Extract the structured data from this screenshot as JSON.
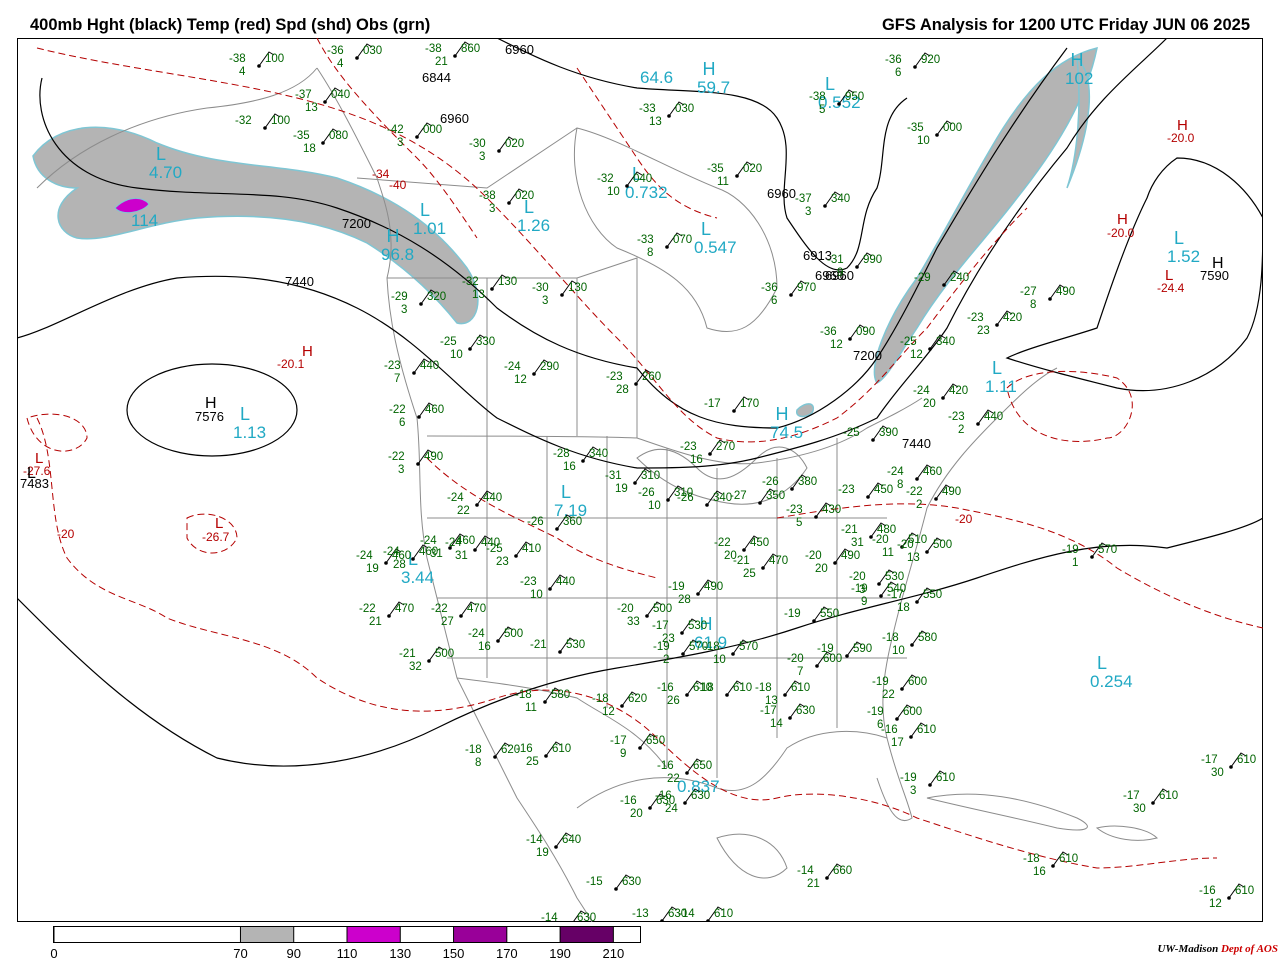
{
  "header": {
    "title_left": "400mb Hght (black) Temp (red) Spd (shd) Obs (grn)",
    "title_right": "GFS Analysis for 1200 UTC Friday  JUN 06 2025"
  },
  "colors": {
    "height_contour": "#000000",
    "temperature_contour": "#b40000",
    "speed_70_90": "#b4b4b4",
    "speed_110_130": "#cc00cc",
    "speed_150_170": "#990099",
    "speed_190_210": "#660066",
    "observation": "#006400",
    "feature_cyan": "#21a9c4",
    "border": "#8c8c8c"
  },
  "legend": {
    "ticks": [
      "0",
      "70",
      "90",
      "110",
      "130",
      "150",
      "170",
      "190",
      "210"
    ],
    "tick_values": [
      0,
      70,
      90,
      110,
      130,
      150,
      170,
      190,
      210
    ],
    "shaded_bands": [
      {
        "from": 70,
        "to": 90,
        "color": "#b4b4b4"
      },
      {
        "from": 110,
        "to": 130,
        "color": "#cc00cc"
      },
      {
        "from": 150,
        "to": 170,
        "color": "#990099"
      },
      {
        "from": 190,
        "to": 210,
        "color": "#660066"
      }
    ]
  },
  "credit": {
    "org": "UW-Madison",
    "dept": "Dept of AOS"
  },
  "height_labels": [
    "6960",
    "6844",
    "6960",
    "6960",
    "6960",
    "7200",
    "7440",
    "6913",
    "6960",
    "7200",
    "7440",
    "7576",
    "7483",
    "7590"
  ],
  "temp_labels": [
    "-20.0",
    "-20.0",
    "-24.4",
    "-20.1",
    "-27.6",
    "-26.7",
    "-20",
    "-20",
    "-40",
    "-34"
  ],
  "pressure_centers": [
    {
      "type": "H",
      "value": "7576"
    },
    {
      "type": "L",
      "value": "7483"
    },
    {
      "type": "H",
      "value": "7590"
    }
  ],
  "speed_features": [
    {
      "type": "L",
      "value": "4.70"
    },
    {
      "type": "",
      "value": "114"
    },
    {
      "type": "L",
      "value": "1.13"
    },
    {
      "type": "H",
      "value": "102"
    },
    {
      "type": "L",
      "value": "1.52"
    },
    {
      "type": "L",
      "value": "1.11"
    },
    {
      "type": "H",
      "value": "74.5"
    },
    {
      "type": "L",
      "value": "7.19"
    },
    {
      "type": "L",
      "value": "3.44"
    },
    {
      "type": "H",
      "value": "61.9"
    },
    {
      "type": "L",
      "value": "0.254"
    },
    {
      "type": "L",
      "value": "1.26"
    },
    {
      "type": "L",
      "value": "0.732"
    },
    {
      "type": "L",
      "value": "0.547"
    },
    {
      "type": "L",
      "value": "0.552"
    },
    {
      "type": "H",
      "value": "96.8"
    },
    {
      "type": "L",
      "value": "1.01"
    },
    {
      "type": "",
      "value": "0.837"
    },
    {
      "type": "H",
      "value": "59.7"
    },
    {
      "type": "",
      "value": "64.6"
    }
  ],
  "observations": [
    {
      "t": "-38",
      "h": "100",
      "dp": "4"
    },
    {
      "t": "-36",
      "h": "030",
      "dp": "4"
    },
    {
      "t": "-38",
      "h": "860",
      "dp": "21"
    },
    {
      "t": "-37",
      "h": "040",
      "dp": "13"
    },
    {
      "t": "-42",
      "h": "000",
      "dp": "3"
    },
    {
      "t": "-32",
      "h": "100",
      "dp": ""
    },
    {
      "t": "-35",
      "h": "080",
      "dp": "18"
    },
    {
      "t": "-30",
      "h": "020",
      "dp": "3"
    },
    {
      "t": "-38",
      "h": "020",
      "dp": "3"
    },
    {
      "t": "-32",
      "h": "040",
      "dp": "10"
    },
    {
      "t": "-33",
      "h": "030",
      "dp": "13"
    },
    {
      "t": "-35",
      "h": "020",
      "dp": "11"
    },
    {
      "t": "-37",
      "h": "340",
      "dp": "3"
    },
    {
      "t": "-36",
      "h": "920",
      "dp": "6"
    },
    {
      "t": "-38",
      "h": "950",
      "dp": "5"
    },
    {
      "t": "-35",
      "h": "000",
      "dp": "10"
    },
    {
      "t": "-33",
      "h": "070",
      "dp": "8"
    },
    {
      "t": "-31",
      "h": "990",
      "dp": "9"
    },
    {
      "t": "-29",
      "h": "240",
      "dp": ""
    },
    {
      "t": "-27",
      "h": "490",
      "dp": "8"
    },
    {
      "t": "-36",
      "h": "970",
      "dp": "6"
    },
    {
      "t": "-32",
      "h": "130",
      "dp": "13"
    },
    {
      "t": "-30",
      "h": "130",
      "dp": "3"
    },
    {
      "t": "-29",
      "h": "320",
      "dp": "3"
    },
    {
      "t": "-25",
      "h": "330",
      "dp": "10"
    },
    {
      "t": "-24",
      "h": "290",
      "dp": "12"
    },
    {
      "t": "-23",
      "h": "260",
      "dp": "28"
    },
    {
      "t": "-36",
      "h": "090",
      "dp": "12"
    },
    {
      "t": "-25",
      "h": "340",
      "dp": "12"
    },
    {
      "t": "-23",
      "h": "420",
      "dp": "23"
    },
    {
      "t": "-23",
      "h": "440",
      "dp": "7"
    },
    {
      "t": "-22",
      "h": "460",
      "dp": "6"
    },
    {
      "t": "-17",
      "h": "170",
      "dp": ""
    },
    {
      "t": "-24",
      "h": "420",
      "dp": "20"
    },
    {
      "t": "-23",
      "h": "440",
      "dp": "2"
    },
    {
      "t": "-22",
      "h": "490",
      "dp": "3"
    },
    {
      "t": "-28",
      "h": "340",
      "dp": "16"
    },
    {
      "t": "-23",
      "h": "270",
      "dp": "16"
    },
    {
      "t": "-25",
      "h": "390",
      "dp": ""
    },
    {
      "t": "-31",
      "h": "310",
      "dp": "19"
    },
    {
      "t": "-26",
      "h": "310",
      "dp": "10"
    },
    {
      "t": "-26",
      "h": "340",
      "dp": ""
    },
    {
      "t": "-27",
      "h": "350",
      "dp": ""
    },
    {
      "t": "-26",
      "h": "380",
      "dp": ""
    },
    {
      "t": "-23",
      "h": "450",
      "dp": ""
    },
    {
      "t": "-24",
      "h": "460",
      "dp": "8"
    },
    {
      "t": "-22",
      "h": "490",
      "dp": "2"
    },
    {
      "t": "-24",
      "h": "440",
      "dp": "22"
    },
    {
      "t": "-26",
      "h": "360",
      "dp": ""
    },
    {
      "t": "-23",
      "h": "430",
      "dp": "5"
    },
    {
      "t": "-21",
      "h": "480",
      "dp": "31"
    },
    {
      "t": "-20",
      "h": "510",
      "dp": "11"
    },
    {
      "t": "-20",
      "h": "500",
      "dp": "13"
    },
    {
      "t": "-24",
      "h": "460",
      "dp": "19"
    },
    {
      "t": "-24",
      "h": "460",
      "dp": "28"
    },
    {
      "t": "-24",
      "h": "460",
      "dp": "31"
    },
    {
      "t": "-24",
      "h": "440",
      "dp": "31"
    },
    {
      "t": "-25",
      "h": "410",
      "dp": "23"
    },
    {
      "t": "-22",
      "h": "450",
      "dp": "20"
    },
    {
      "t": "-21",
      "h": "470",
      "dp": "25"
    },
    {
      "t": "-20",
      "h": "490",
      "dp": "20"
    },
    {
      "t": "-20",
      "h": "530",
      "dp": "3"
    },
    {
      "t": "-19",
      "h": "540",
      "dp": "9"
    },
    {
      "t": "-17",
      "h": "550",
      "dp": "18"
    },
    {
      "t": "-19",
      "h": "570",
      "dp": "1"
    },
    {
      "t": "-23",
      "h": "440",
      "dp": "10"
    },
    {
      "t": "-19",
      "h": "490",
      "dp": "28"
    },
    {
      "t": "-22",
      "h": "470",
      "dp": "21"
    },
    {
      "t": "-22",
      "h": "470",
      "dp": "27"
    },
    {
      "t": "-24",
      "h": "500",
      "dp": "16"
    },
    {
      "t": "-20",
      "h": "500",
      "dp": "33"
    },
    {
      "t": "-17",
      "h": "530",
      "dp": "23"
    },
    {
      "t": "-19",
      "h": "550",
      "dp": ""
    },
    {
      "t": "-21",
      "h": "500",
      "dp": "32"
    },
    {
      "t": "-21",
      "h": "530",
      "dp": ""
    },
    {
      "t": "-19",
      "h": "570",
      "dp": "2"
    },
    {
      "t": "-18",
      "h": "570",
      "dp": "10"
    },
    {
      "t": "-20",
      "h": "600",
      "dp": "7"
    },
    {
      "t": "-19",
      "h": "590",
      "dp": ""
    },
    {
      "t": "-18",
      "h": "580",
      "dp": "10"
    },
    {
      "t": "-18",
      "h": "580",
      "dp": "11"
    },
    {
      "t": "-18",
      "h": "620",
      "dp": "12"
    },
    {
      "t": "-16",
      "h": "610",
      "dp": "26"
    },
    {
      "t": "-18",
      "h": "610",
      "dp": ""
    },
    {
      "t": "-18",
      "h": "610",
      "dp": "13"
    },
    {
      "t": "-17",
      "h": "630",
      "dp": "14"
    },
    {
      "t": "-19",
      "h": "600",
      "dp": "22"
    },
    {
      "t": "-19",
      "h": "600",
      "dp": "6"
    },
    {
      "t": "-16",
      "h": "610",
      "dp": "17"
    },
    {
      "t": "-18",
      "h": "620",
      "dp": "8"
    },
    {
      "t": "-16",
      "h": "610",
      "dp": "25"
    },
    {
      "t": "-17",
      "h": "650",
      "dp": "9"
    },
    {
      "t": "-16",
      "h": "650",
      "dp": "22"
    },
    {
      "t": "-16",
      "h": "630",
      "dp": "20"
    },
    {
      "t": "-19",
      "h": "610",
      "dp": "3"
    },
    {
      "t": "-17",
      "h": "610",
      "dp": "30"
    },
    {
      "t": "-17",
      "h": "610",
      "dp": "30"
    },
    {
      "t": "-14",
      "h": "640",
      "dp": "19"
    },
    {
      "t": "-15",
      "h": "630",
      "dp": ""
    },
    {
      "t": "-14",
      "h": "630",
      "dp": ""
    },
    {
      "t": "-13",
      "h": "630",
      "dp": ""
    },
    {
      "t": "-14",
      "h": "610",
      "dp": ""
    },
    {
      "t": "-14",
      "h": "660",
      "dp": "21"
    },
    {
      "t": "-18",
      "h": "610",
      "dp": "16"
    },
    {
      "t": "-16",
      "h": "610",
      "dp": "12"
    },
    {
      "t": "-16",
      "h": "630",
      "dp": "24"
    }
  ]
}
